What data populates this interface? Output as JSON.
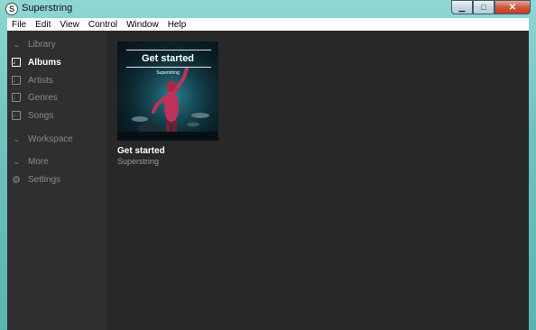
{
  "window": {
    "title": "Superstring",
    "app_icon_letter": "S"
  },
  "window_controls": {
    "minimize": "▁",
    "maximize": "□",
    "close": "✕"
  },
  "menubar": {
    "items": [
      "File",
      "Edit",
      "View",
      "Control",
      "Window",
      "Help"
    ]
  },
  "sidebar": {
    "library_label": "Library",
    "items": [
      {
        "label": "Albums",
        "icon": "music-note-icon",
        "active": true
      },
      {
        "label": "Artists",
        "icon": "music-note-icon",
        "active": false
      },
      {
        "label": "Genres",
        "icon": "music-note-icon",
        "active": false
      },
      {
        "label": "Songs",
        "icon": "music-note-icon",
        "active": false
      }
    ],
    "workspace_label": "Workspace",
    "more_label": "More",
    "settings_label": "Settings"
  },
  "albums": [
    {
      "cover_title": "Get started",
      "cover_subtitle": "Superstring",
      "title": "Get started",
      "artist": "Superstring"
    }
  ],
  "colors": {
    "sidebar_bg": "#2f2f2f",
    "content_bg": "#282828",
    "active_text": "#ffffff",
    "inactive_text": "#8a8a8a",
    "cover_accent": "#c0325a"
  }
}
